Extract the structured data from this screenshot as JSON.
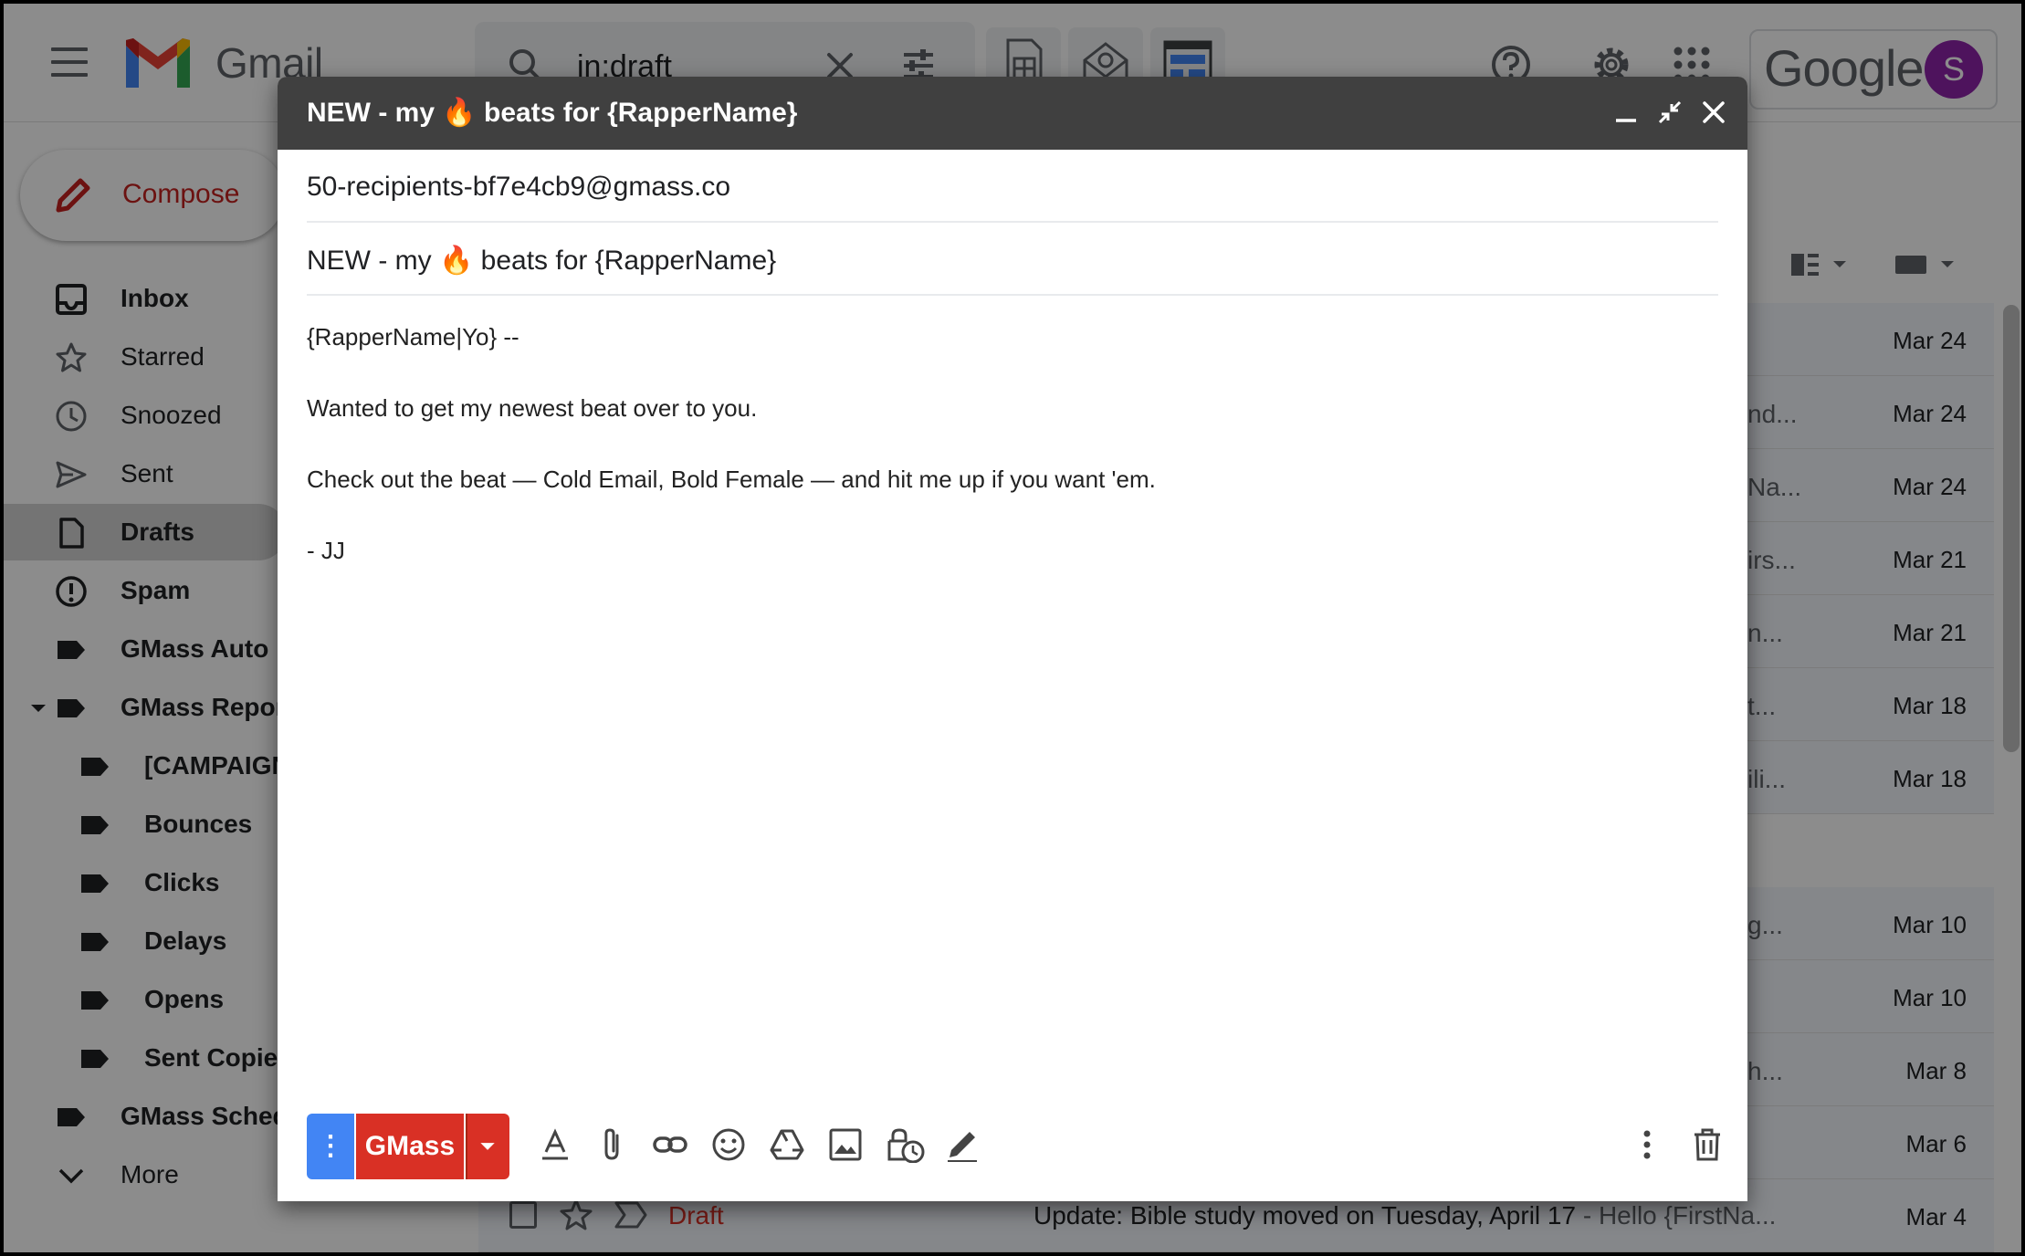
{
  "header": {
    "app_name": "Gmail",
    "search_value": "in:draft",
    "google_word": "Google",
    "avatar_initial": "S"
  },
  "sidebar": {
    "compose_label": "Compose",
    "items": [
      {
        "label": "Inbox",
        "bold": true
      },
      {
        "label": "Starred",
        "bold": false
      },
      {
        "label": "Snoozed",
        "bold": false
      },
      {
        "label": "Sent",
        "bold": false
      },
      {
        "label": "Drafts",
        "bold": true,
        "active": true
      },
      {
        "label": "Spam",
        "bold": true
      },
      {
        "label": "GMass Auto F",
        "bold": true
      },
      {
        "label": "GMass Repor",
        "bold": true
      },
      {
        "label": "[CAMPAIGN",
        "bold": true
      },
      {
        "label": "Bounces",
        "bold": true
      },
      {
        "label": "Clicks",
        "bold": true
      },
      {
        "label": "Delays",
        "bold": true
      },
      {
        "label": "Opens",
        "bold": true
      },
      {
        "label": "Sent Copies",
        "bold": true
      },
      {
        "label": "GMass Sched",
        "bold": true
      },
      {
        "label": "More",
        "bold": false
      }
    ]
  },
  "list": {
    "rows": [
      {
        "snippet": "",
        "date": "Mar 24"
      },
      {
        "snippet": "nd...",
        "date": "Mar 24"
      },
      {
        "snippet": "Na...",
        "date": "Mar 24"
      },
      {
        "snippet": "irs...",
        "date": "Mar 21"
      },
      {
        "snippet": "n...",
        "date": "Mar 21"
      },
      {
        "snippet": "t...",
        "date": "Mar 18"
      },
      {
        "snippet": "ili...",
        "date": "Mar 18"
      },
      {
        "snippet": "g...",
        "date": "Mar 10"
      },
      {
        "snippet": "",
        "date": "Mar 10"
      },
      {
        "snippet": "h...",
        "date": "Mar 8"
      },
      {
        "snippet": "",
        "date": "Mar 6"
      }
    ],
    "last_row": {
      "label": "Draft",
      "subject": "Update: Bible study moved on Tuesday, April 17",
      "snippet": " - Hello {FirstNa...",
      "date": "Mar 4"
    }
  },
  "compose": {
    "title": "NEW - my 🔥 beats for {RapperName}",
    "to": "50-recipients-bf7e4cb9@gmass.co",
    "subject": "NEW - my 🔥 beats for {RapperName}",
    "body": [
      "{RapperName|Yo} --",
      "Wanted to get my newest beat over to you.",
      "Check out the beat — Cold Email, Bold Female — and hit me up if you want 'em.",
      "- JJ"
    ],
    "options_label": "⋮",
    "send_label": "GMass"
  },
  "colors": {
    "gmass_red": "#d93025",
    "options_blue": "#4285f4",
    "titlebar": "#404040",
    "avatar": "#8e24aa"
  }
}
